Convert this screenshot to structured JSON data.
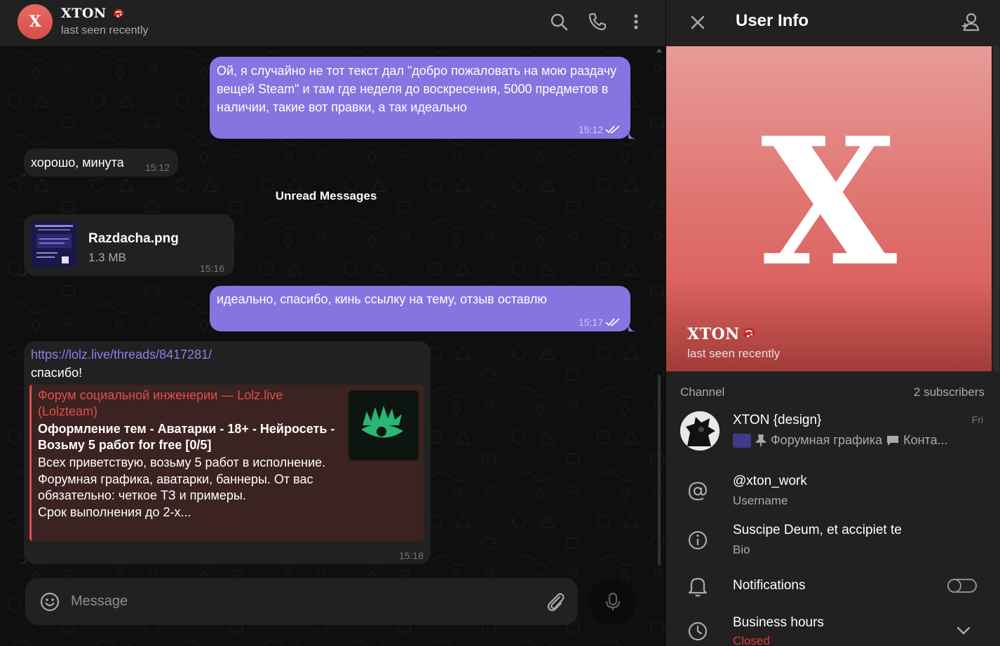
{
  "header": {
    "avatar_letter": "X",
    "name": "XTON",
    "status": "last seen recently",
    "icons": [
      "search-icon",
      "phone-icon",
      "more-vertical-icon"
    ]
  },
  "messages": [
    {
      "dir": "out",
      "text": "Ой, я случайно не тот текст дал \"добро пожаловать на мою раздачу вещей Steam\" и там где неделя до воскресения, 5000 предметов в наличии, такие вот правки, а так идеально",
      "time": "15:12",
      "read": true
    },
    {
      "dir": "in",
      "text": "хорошо, минута",
      "time": "15:12"
    },
    {
      "dir": "in",
      "type": "file",
      "file_name": "Razdacha.png",
      "file_size": "1.3 MB",
      "time": "15:16"
    },
    {
      "dir": "out",
      "text": "идеально, спасибо, кинь ссылку на тему, отзыв оставлю",
      "time": "15:17",
      "read": true
    },
    {
      "dir": "in",
      "link": "https://lolz.live/threads/8417281/",
      "text": "спасибо!",
      "time": "15:18",
      "preview": {
        "site": "Форум социальной инженерии — Lolz.live (Lolzteam)",
        "title": "Оформление тем - Аватарки - 18+ - Нейросеть - Возьму 5 работ for free [0/5]",
        "description": "Всех приветствую, возьму 5 работ в исполнение. Форумная графика, аватарки, баннеры. От вас обязательно: четкое ТЗ и примеры.\nСрок выполнения до 2-х..."
      }
    }
  ],
  "unread_separator": "Unread Messages",
  "composer": {
    "placeholder": "Message",
    "icons": [
      "emoji-icon",
      "attach-icon",
      "microphone-icon"
    ]
  },
  "info": {
    "title": "User Info",
    "avatar_letter": "X",
    "name": "XTON",
    "status": "last seen recently",
    "channel": {
      "section_label": "Channel",
      "subscribers": "2 subscribers",
      "name": "XTON {design}",
      "date": "Fri",
      "last_post": "Форумная графика",
      "last_post_more": "Конта..."
    },
    "username": {
      "value": "@xton_work",
      "label": "Username"
    },
    "bio": {
      "value": "Suscipe Deum, et accipiet te",
      "label": "Bio"
    },
    "notifications": {
      "label": "Notifications",
      "enabled": false
    },
    "business_hours": {
      "label": "Business hours",
      "status": "Closed"
    }
  },
  "colors": {
    "accent": "#8774e1",
    "panel": "#212121",
    "chat_bg": "#0f0f0f",
    "link_red": "#e14f48",
    "closed_red": "#e53935"
  }
}
